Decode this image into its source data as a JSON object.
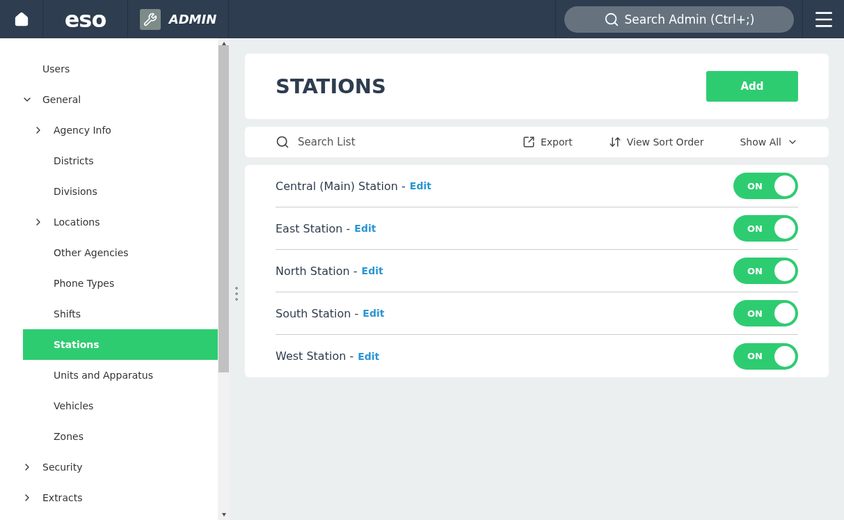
{
  "header": {
    "logo": "eso",
    "app_title": "ADMIN",
    "search": {
      "placeholder": "Search Admin (Ctrl+;)"
    }
  },
  "sidebar": {
    "items": [
      {
        "label": "Users",
        "selected": false
      },
      {
        "label": "General",
        "selected": false,
        "expanded": true,
        "children": [
          {
            "label": "Agency Info",
            "selected": false,
            "expanded": false
          },
          {
            "label": "Districts",
            "selected": false
          },
          {
            "label": "Divisions",
            "selected": false
          },
          {
            "label": "Locations",
            "selected": false,
            "expanded": false
          },
          {
            "label": "Other Agencies",
            "selected": false
          },
          {
            "label": "Phone Types",
            "selected": false
          },
          {
            "label": "Shifts",
            "selected": false
          },
          {
            "label": "Stations",
            "selected": true
          },
          {
            "label": "Units and Apparatus",
            "selected": false
          },
          {
            "label": "Vehicles",
            "selected": false
          },
          {
            "label": "Zones",
            "selected": false
          }
        ]
      },
      {
        "label": "Security",
        "selected": false,
        "expanded": false
      },
      {
        "label": "Extracts",
        "selected": false,
        "expanded": false
      }
    ]
  },
  "page": {
    "title": "STATIONS",
    "add_button": "Add"
  },
  "toolbar": {
    "search": {
      "placeholder": "Search List"
    },
    "export": "Export",
    "sort": "View Sort Order",
    "filter": "Show All"
  },
  "stations": [
    {
      "name": "Central (Main) Station -",
      "edit": "Edit",
      "toggle": "ON",
      "on": true
    },
    {
      "name": "East Station -",
      "edit": "Edit",
      "toggle": "ON",
      "on": true
    },
    {
      "name": "North Station -",
      "edit": "Edit",
      "toggle": "ON",
      "on": true
    },
    {
      "name": "South Station -",
      "edit": "Edit",
      "toggle": "ON",
      "on": true
    },
    {
      "name": "West Station -",
      "edit": "Edit",
      "toggle": "ON",
      "on": true
    }
  ]
}
